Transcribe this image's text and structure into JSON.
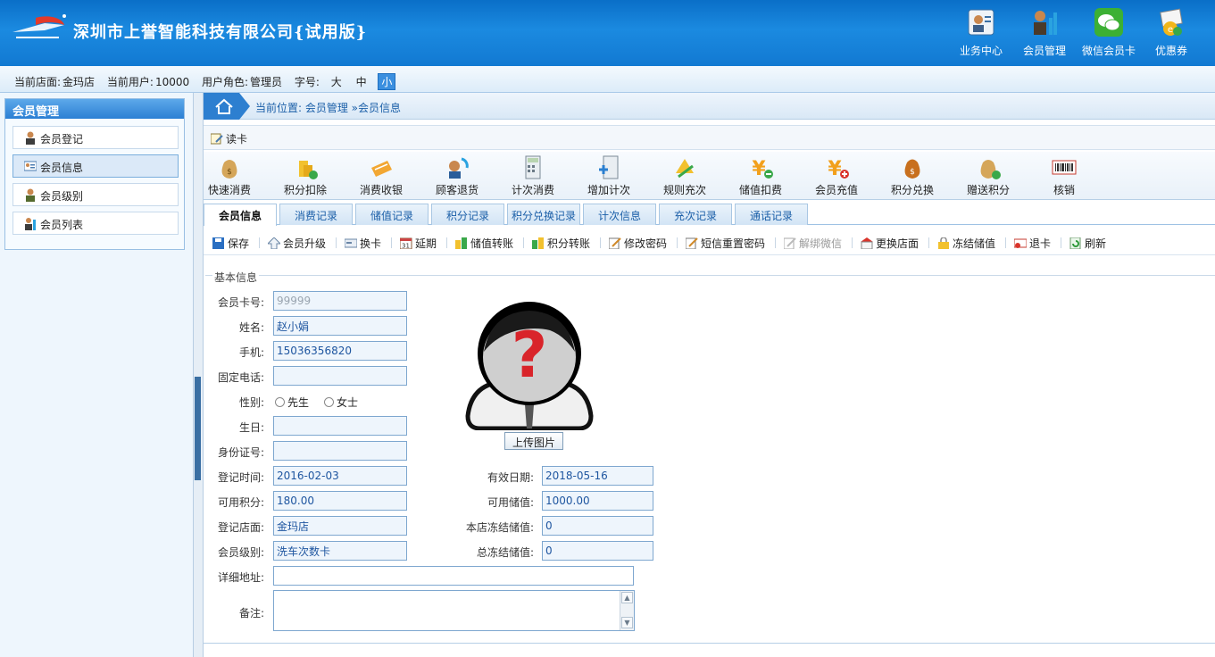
{
  "header": {
    "company": "深圳市上誉智能科技有限公司{试用版}",
    "nav": [
      {
        "label": "业务中心",
        "icon": "business-center-icon"
      },
      {
        "label": "会员管理",
        "icon": "member-management-icon"
      },
      {
        "label": "微信会员卡",
        "icon": "wechat-icon"
      },
      {
        "label": "优惠券",
        "icon": "coupon-icon"
      }
    ]
  },
  "infobar": {
    "store_label": "当前店面:",
    "store": "金玛店",
    "user_label": "当前用户:",
    "user": "10000",
    "role_label": "用户角色:",
    "role": "管理员",
    "fontsize_label": "字号:",
    "sizes": [
      "大",
      "中",
      "小"
    ]
  },
  "sidebar": {
    "title": "会员管理",
    "items": [
      {
        "label": "会员登记"
      },
      {
        "label": "会员信息"
      },
      {
        "label": "会员级别"
      },
      {
        "label": "会员列表"
      }
    ]
  },
  "breadcrumb": "当前位置: 会员管理 »会员信息",
  "readcard": "读卡",
  "bigtools": [
    "快速消费",
    "积分扣除",
    "消费收银",
    "顾客退货",
    "计次消费",
    "增加计次",
    "规则充次",
    "储值扣费",
    "会员充值",
    "积分兑换",
    "赠送积分",
    "核销"
  ],
  "tabs": [
    "会员信息",
    "消费记录",
    "储值记录",
    "积分记录",
    "积分兑换记录",
    "计次信息",
    "充次记录",
    "通话记录"
  ],
  "actions": [
    {
      "label": "保存"
    },
    {
      "label": "会员升级"
    },
    {
      "label": "换卡"
    },
    {
      "label": "延期"
    },
    {
      "label": "储值转账"
    },
    {
      "label": "积分转账"
    },
    {
      "label": "修改密码"
    },
    {
      "label": "短信重置密码"
    },
    {
      "label": "解绑微信"
    },
    {
      "label": "更换店面"
    },
    {
      "label": "冻结储值"
    },
    {
      "label": "退卡"
    },
    {
      "label": "刷新"
    }
  ],
  "form": {
    "legend": "基本信息",
    "card_no": {
      "label": "会员卡号:",
      "value": "99999"
    },
    "name": {
      "label": "姓名:",
      "value": "赵小娟"
    },
    "mobile": {
      "label": "手机:",
      "value": "15036356820"
    },
    "phone": {
      "label": "固定电话:",
      "value": ""
    },
    "gender": {
      "label": "性别:",
      "options": [
        "先生",
        "女士"
      ]
    },
    "birthday": {
      "label": "生日:",
      "value": ""
    },
    "id_no": {
      "label": "身份证号:",
      "value": ""
    },
    "reg_time": {
      "label": "登记时间:",
      "value": "2016-02-03"
    },
    "points": {
      "label": "可用积分:",
      "value": "180.00"
    },
    "reg_store": {
      "label": "登记店面:",
      "value": "金玛店"
    },
    "level": {
      "label": "会员级别:",
      "value": "洗车次数卡"
    },
    "address": {
      "label": "详细地址:",
      "value": ""
    },
    "remark": {
      "label": "备注:",
      "value": ""
    },
    "expiry": {
      "label": "有效日期:",
      "value": "2018-05-16"
    },
    "balance": {
      "label": "可用储值:",
      "value": "1000.00"
    },
    "store_frozen": {
      "label": "本店冻结储值:",
      "value": "0"
    },
    "total_frozen": {
      "label": "总冻结储值:",
      "value": "0"
    },
    "upload": "上传图片"
  }
}
